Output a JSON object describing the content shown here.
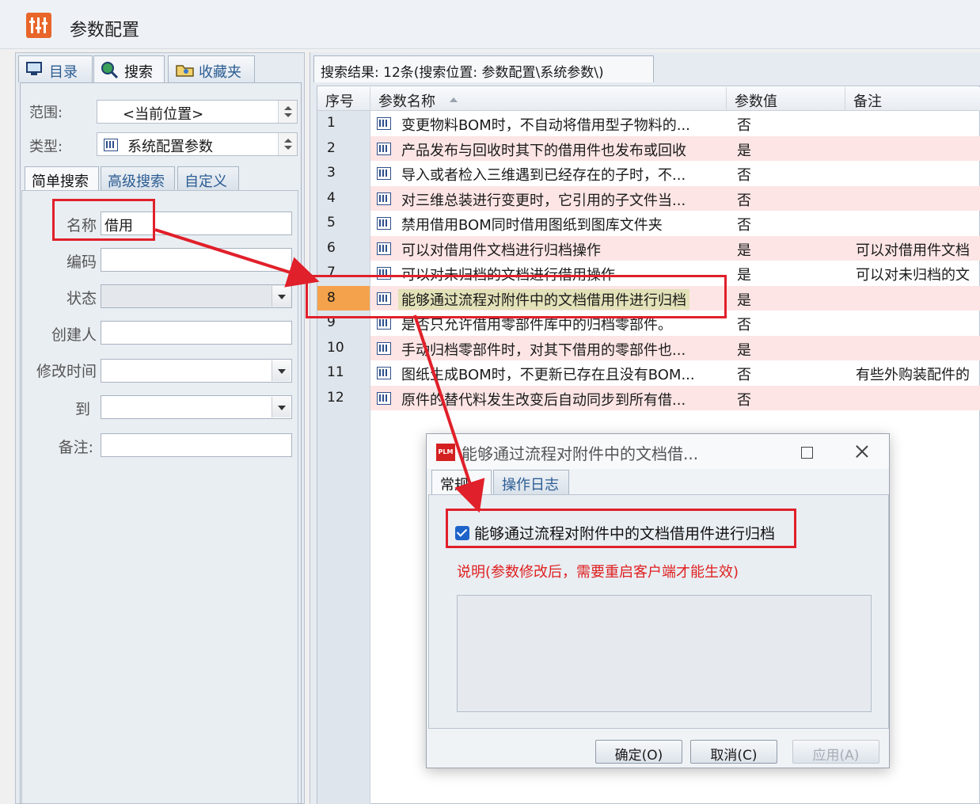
{
  "window": {
    "title": "参数配置"
  },
  "left": {
    "tabs": [
      {
        "label": "目录",
        "icon": "monitor-icon"
      },
      {
        "label": "搜索",
        "icon": "search-globe-icon"
      },
      {
        "label": "收藏夹",
        "icon": "favorites-folder-icon"
      }
    ],
    "scope_label": "范围:",
    "scope_value": "<当前位置>",
    "type_label": "类型:",
    "type_value": "系统配置参数",
    "sub_tabs": [
      "简单搜索",
      "高级搜索",
      "自定义"
    ],
    "fields": {
      "name_label": "名称",
      "name_value": "借用",
      "code_label": "编码",
      "code_value": "",
      "status_label": "状态",
      "status_value": "",
      "creator_label": "创建人",
      "creator_value": "",
      "modified_label": "修改时间",
      "modified_value": "",
      "to_label": "到",
      "to_value": "",
      "remark_label": "备注:",
      "remark_value": ""
    }
  },
  "results": {
    "tab_label": "搜索结果: 12条(搜索位置: 参数配置\\系统参数\\)",
    "columns": [
      "序号",
      "参数名称",
      "参数值",
      "备注"
    ],
    "rows": [
      {
        "n": "1",
        "name": "变更物料BOM时，不自动将借用型子物料的...",
        "value": "否",
        "note": ""
      },
      {
        "n": "2",
        "name": "产品发布与回收时其下的借用件也发布或回收",
        "value": "是",
        "note": ""
      },
      {
        "n": "3",
        "name": "导入或者检入三维遇到已经存在的子时，不...",
        "value": "否",
        "note": ""
      },
      {
        "n": "4",
        "name": "对三维总装进行变更时，它引用的子文件当...",
        "value": "否",
        "note": ""
      },
      {
        "n": "5",
        "name": "禁用借用BOM同时借用图纸到图库文件夹",
        "value": "否",
        "note": ""
      },
      {
        "n": "6",
        "name": "可以对借用件文档进行归档操作",
        "value": "是",
        "note": "可以对借用件文档"
      },
      {
        "n": "7",
        "name": "可以对未归档的文档进行借用操作",
        "value": "是",
        "note": "可以对未归档的文"
      },
      {
        "n": "8",
        "name": "能够通过流程对附件中的文档借用件进行归档",
        "value": "是",
        "note": ""
      },
      {
        "n": "9",
        "name": "是否只允许借用零部件库中的归档零部件。",
        "value": "否",
        "note": ""
      },
      {
        "n": "10",
        "name": "手动归档零部件时，对其下借用的零部件也...",
        "value": "是",
        "note": ""
      },
      {
        "n": "11",
        "name": "图纸生成BOM时，不更新已存在且没有BOM...",
        "value": "否",
        "note": "有些外购装配件的"
      },
      {
        "n": "12",
        "name": "原件的替代料发生改变后自动同步到所有借...",
        "value": "否",
        "note": ""
      }
    ],
    "selected_row": "8"
  },
  "dialog": {
    "icon_text": "PLM",
    "title": "能够通过流程对附件中的文档借...",
    "tabs": [
      "常规",
      "操作日志"
    ],
    "checkbox_label": "能够通过流程对附件中的文档借用件进行归档",
    "checkbox_checked": true,
    "note": "说明(参数修改后，需要重启客户端才能生效)",
    "buttons": {
      "ok": "确定(O)",
      "cancel": "取消(C)",
      "apply": "应用(A)"
    }
  },
  "colors": {
    "annotation_red": "#e0202a",
    "selected_row": "#f4a24b",
    "pink_row": "#fde5e5",
    "note_text": "#e02020"
  }
}
